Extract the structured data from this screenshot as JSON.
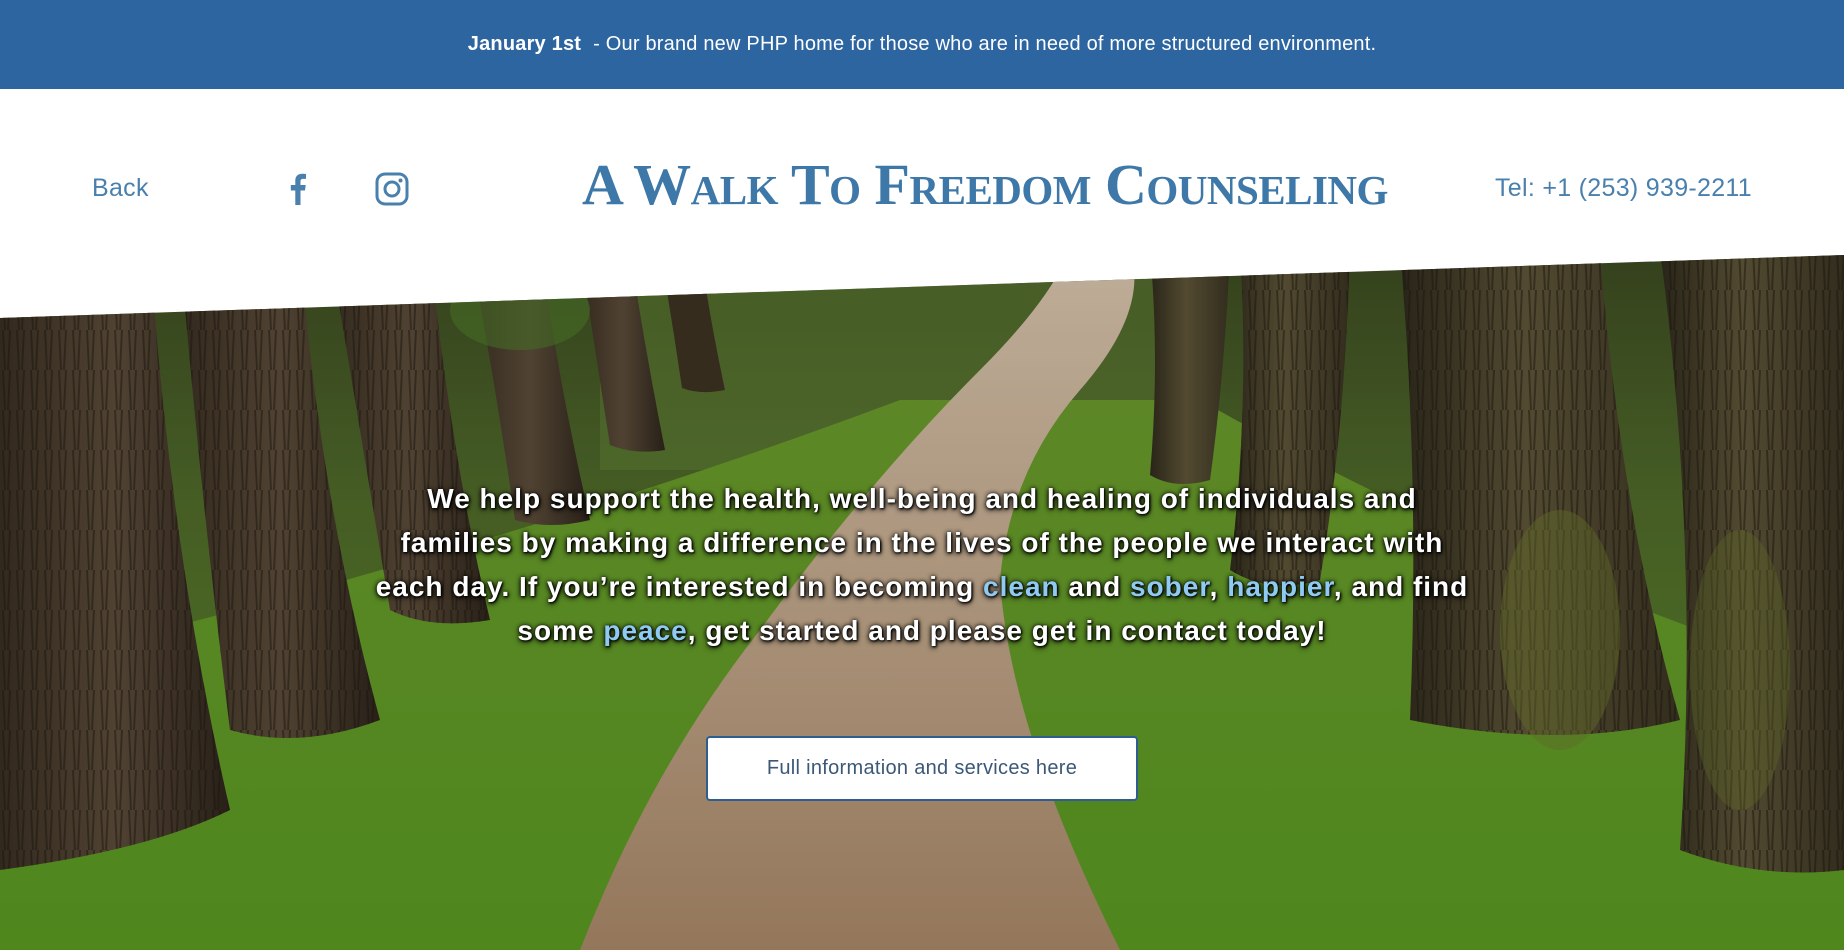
{
  "announcement": {
    "date": "January 1st",
    "message": "- Our brand new PHP home for those who are in need of more structured environment."
  },
  "header": {
    "back_label": "Back",
    "social": [
      {
        "name": "facebook",
        "icon": "facebook-icon"
      },
      {
        "name": "instagram",
        "icon": "instagram-icon"
      }
    ],
    "brand": "A Walk To Freedom Counseling",
    "phone": "Tel: +1 (253) 939-2211"
  },
  "hero": {
    "text_1": "We help support the health, well-being and healing of individuals and families by making a difference in the lives of the people we interact with each day. If you’re interested in becoming ",
    "hl_1": "clean",
    "text_2": " and ",
    "hl_2": "sober",
    "text_3": ", ",
    "hl_3": "happier",
    "text_4": ", and find some ",
    "hl_4": "peace",
    "text_5": ", get started and please get in contact today!",
    "cta_label": "Full information and services here"
  },
  "colors": {
    "announce_bg": "#2d65a1",
    "brand": "#3d78a8",
    "link": "#4a80ad",
    "highlight": "#8fcaf2",
    "button_border": "#2d5e8f"
  }
}
